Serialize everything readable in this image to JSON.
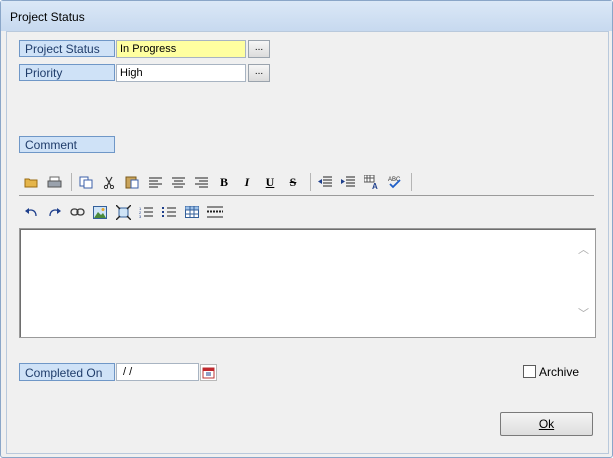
{
  "window": {
    "title": "Project Status"
  },
  "fields": {
    "project_status": {
      "label": "Project Status",
      "value": "In Progress",
      "button": "..."
    },
    "priority": {
      "label": "Priority",
      "value": "High",
      "button": "..."
    }
  },
  "comment": {
    "label": "Comment",
    "text": ""
  },
  "toolbar1": [
    "open-icon",
    "print-icon",
    "copy-icon",
    "cut-icon",
    "paste-icon",
    "align-left-icon",
    "align-center-icon",
    "align-right-icon",
    "bold-icon",
    "italic-icon",
    "underline-icon",
    "strikethrough-icon",
    "outdent-icon",
    "indent-icon",
    "font-color-icon",
    "spellcheck-icon"
  ],
  "toolbar1_text": {
    "bold": "B",
    "italic": "I",
    "underline": "U",
    "strike": "S"
  },
  "toolbar2": [
    "undo-icon",
    "redo-icon",
    "link-icon",
    "image-icon",
    "resize-icon",
    "numbered-list-icon",
    "bullet-list-icon",
    "table-icon",
    "horizontal-rule-icon"
  ],
  "completed_on": {
    "label": "Completed On",
    "value": " / /"
  },
  "archive": {
    "label": "Archive",
    "checked": false
  },
  "ok_button": {
    "label": "Ok"
  }
}
